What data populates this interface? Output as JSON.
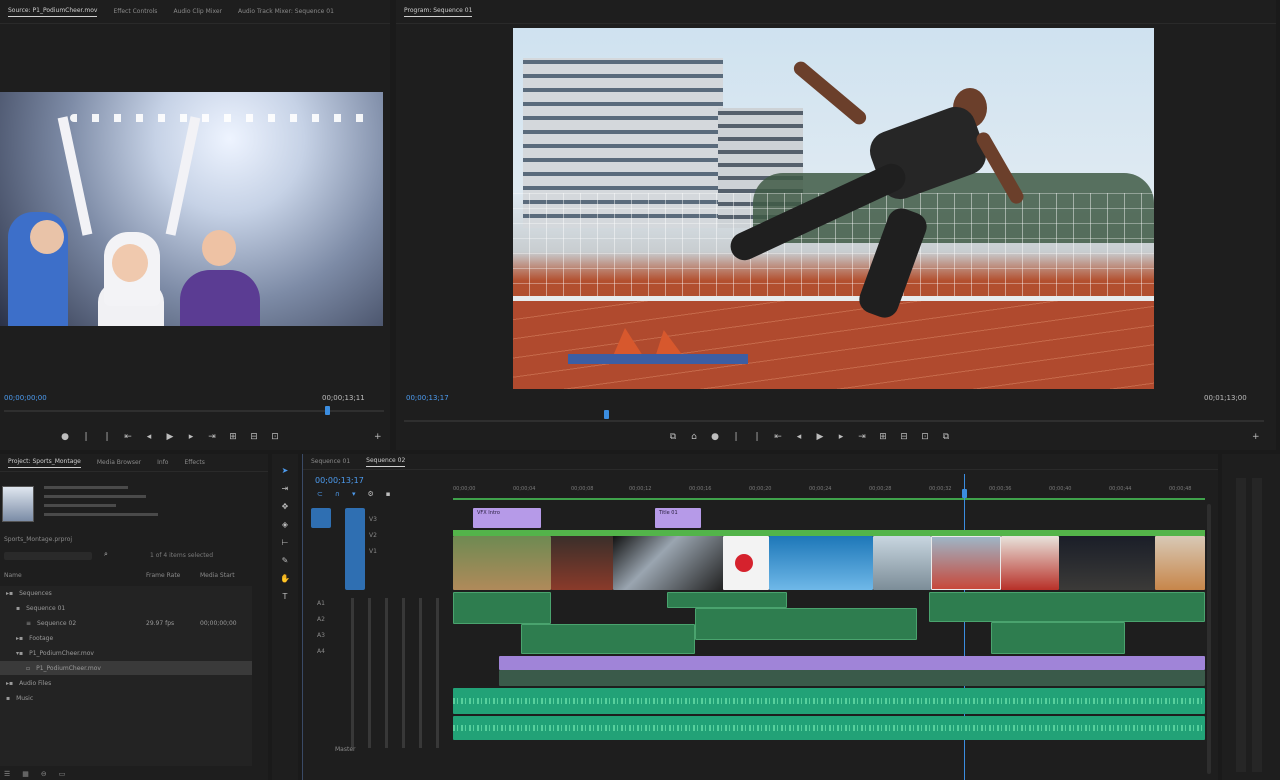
{
  "source_monitor": {
    "tabs": [
      "Source: P1_PodiumCheer.mov",
      "Effect Controls",
      "Audio Clip Mixer",
      "Audio Track Mixer: Sequence 01"
    ],
    "timecode_in": "00;00;00;00",
    "timecode_out": "00;00;13;11",
    "controls": [
      "●",
      "|",
      "|",
      "⇤",
      "◂",
      "▶",
      "▸",
      "⇥",
      "⊞",
      "⊟",
      "⊡",
      "+"
    ]
  },
  "program_monitor": {
    "tabs": [
      "Program: Sequence 01"
    ],
    "timecode_in": "00;00;13;17",
    "timecode_out": "00;01;13;00",
    "controls": [
      "⧉",
      "⌂",
      "●",
      "|",
      "|",
      "⇤",
      "◂",
      "▶",
      "▸",
      "⇥",
      "⊞",
      "⊟",
      "⊡",
      "⧉",
      "+"
    ]
  },
  "project_panel": {
    "tabs": [
      "Project: Sports_Montage",
      "Media Browser",
      "Info",
      "Effects"
    ],
    "file_name": "Sports_Montage.prproj",
    "items_label": "1 of 4 items selected",
    "columns": [
      "Name",
      "Frame Rate",
      "Media Start"
    ],
    "rows": [
      {
        "name": "Sequences",
        "rate": "",
        "start": ""
      },
      {
        "name": "Sequence 01",
        "rate": "",
        "start": ""
      },
      {
        "name": "Sequence 02",
        "rate": "29.97 fps",
        "start": "00;00;00;00"
      },
      {
        "name": "Footage",
        "rate": "",
        "start": ""
      },
      {
        "name": "P1_PodiumCheer.mov",
        "rate": "",
        "start": ""
      },
      {
        "name": "Audio Files",
        "rate": "",
        "start": ""
      },
      {
        "name": "Music",
        "rate": "",
        "start": ""
      }
    ]
  },
  "timeline": {
    "tabs": [
      "Sequence 01",
      "Sequence 02"
    ],
    "timecode": "00;00;13;17",
    "ruler": [
      "00;00;00",
      "00;00;04",
      "00;00;08",
      "00;00;12",
      "00;00;16",
      "00;00;20",
      "00;00;24",
      "00;00;28",
      "00;00;32",
      "00;00;36",
      "00;00;40",
      "00;00;44",
      "00;00;48"
    ],
    "tracks": [
      "V3",
      "V2",
      "V1",
      "A1",
      "A2",
      "A3",
      "A4",
      "Master"
    ],
    "title_clips": [
      "VFX Intro",
      "Title 01"
    ]
  },
  "colors": {
    "accent_blue": "#3b8de0",
    "audio_green": "#2e7d4f",
    "audio_teal": "#22a277",
    "purple_clip": "#a084d8"
  }
}
